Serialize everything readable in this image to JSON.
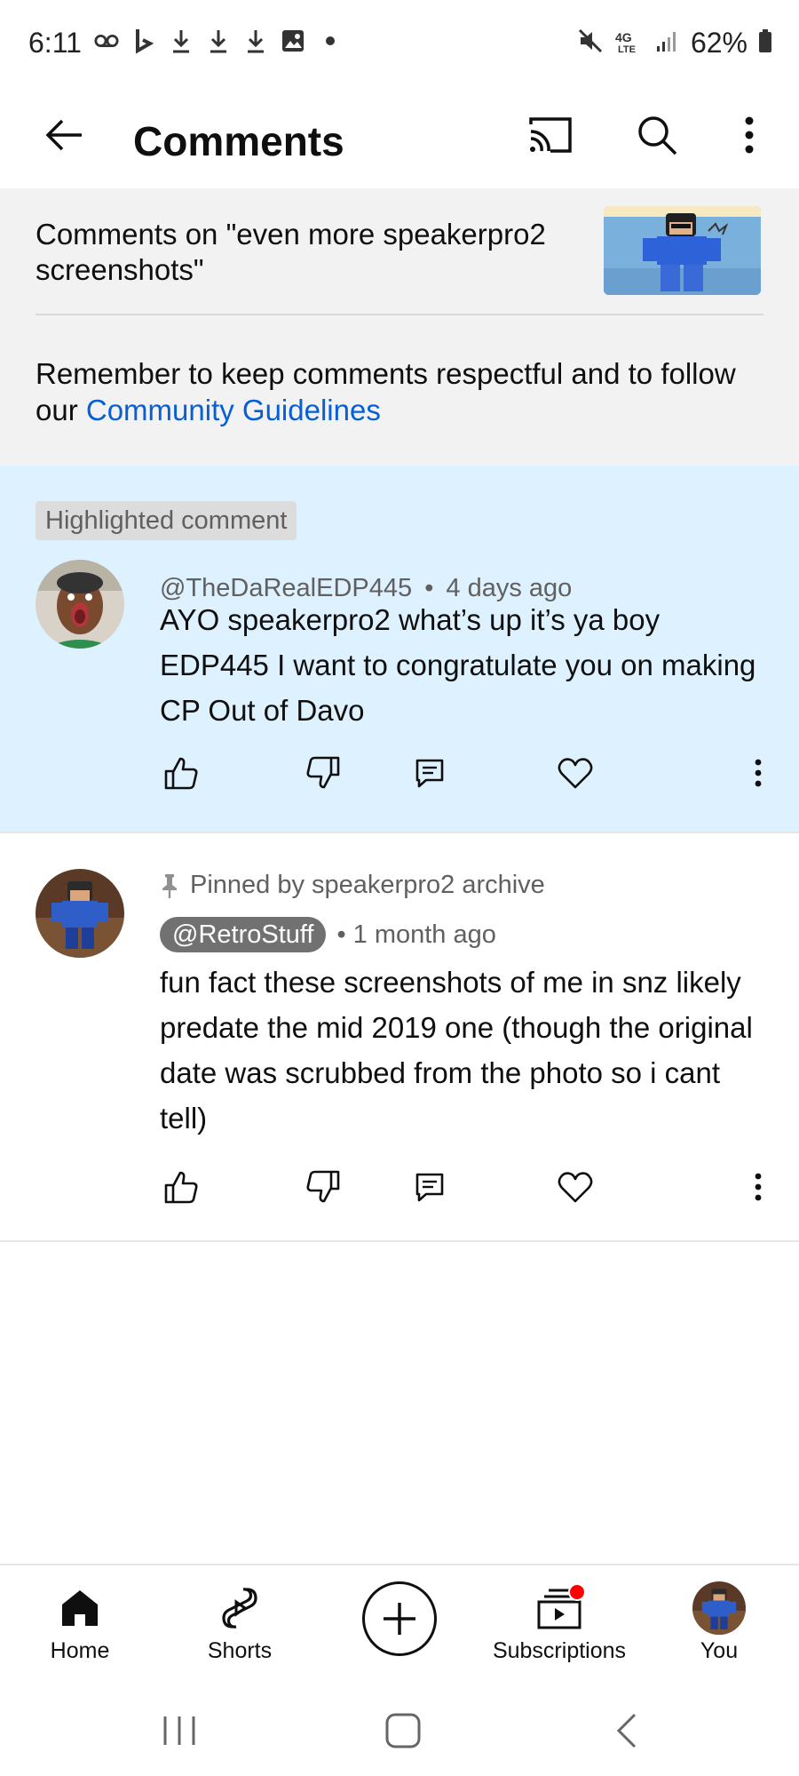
{
  "status_bar": {
    "time": "6:11",
    "battery": "62%"
  },
  "header": {
    "title": "Comments"
  },
  "video": {
    "title": "Comments on \"even more speakerpro2 screenshots\"",
    "guidelines_text": "Remember to keep comments respectful and to follow our ",
    "guidelines_link": "Community Guidelines"
  },
  "highlighted_comment": {
    "badge": "Highlighted comment",
    "author": "@TheDaRealEDP445",
    "separator": "•",
    "time": "4 days ago",
    "text": "AYO speakerpro2 what’s up it’s ya boy EDP445 I want to congratulate you on making CP Out of Davo"
  },
  "pinned_comment": {
    "pinned_label": "Pinned by speakerpro2 archive",
    "author": "@RetroStuff",
    "separator": "•",
    "time": "1 month ago",
    "text": "fun fact these screenshots of me in snz likely predate the mid 2019 one (though the original date was scrubbed from the photo so i cant tell)"
  },
  "bottom_nav": {
    "items": [
      {
        "label": "Home",
        "icon": "home-icon"
      },
      {
        "label": "Shorts",
        "icon": "shorts-icon"
      },
      {
        "label": "Subscriptions",
        "icon": "subscriptions-icon"
      },
      {
        "label": "You",
        "icon": "avatar"
      }
    ]
  },
  "colors": {
    "accent_link": "#065fd4",
    "highlight_bg": "#def1fe",
    "notification": "#ff0000"
  }
}
